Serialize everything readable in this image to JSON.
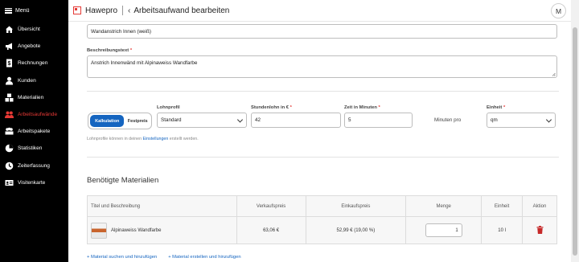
{
  "sidebar": {
    "menu_label": "Menü",
    "items": [
      {
        "label": "Übersicht",
        "icon": "home-icon"
      },
      {
        "label": "Angebote",
        "icon": "megaphone-icon"
      },
      {
        "label": "Rechnungen",
        "icon": "invoice-icon"
      },
      {
        "label": "Kunden",
        "icon": "user-icon"
      },
      {
        "label": "Materialien",
        "icon": "boxes-icon"
      },
      {
        "label": "Arbeitsaufwände",
        "icon": "people-icon",
        "active": true
      },
      {
        "label": "Arbeitspakete",
        "icon": "package-icon"
      },
      {
        "label": "Statistiken",
        "icon": "pie-chart-icon"
      },
      {
        "label": "Zeiterfassung",
        "icon": "clock-icon"
      },
      {
        "label": "Visitenkarte",
        "icon": "id-card-icon"
      }
    ]
  },
  "header": {
    "app_name": "Hawepro",
    "back_symbol": "‹",
    "title": "Arbeitsaufwand bearbeiten",
    "avatar_initial": "M"
  },
  "form": {
    "name_value": "Wandanstrich Innen (weiß)",
    "description_label": "Beschreibungstext",
    "description_value": "Anstrich Innenwänd mit Alpinaweiss Wandfarbe",
    "required_mark": "*",
    "mode_toggle": {
      "active": "Kalkulation",
      "inactive": "Festpreis"
    },
    "lohnprofil_label": "Lohnprofil",
    "lohnprofil_value": "Standard",
    "stundenlohn_label": "Stundenlohn in €",
    "stundenlohn_value": "42",
    "zeit_label": "Zeit in Minuten",
    "zeit_value": "5",
    "minuten_pro": "Minuten pro",
    "einheit_label": "Einheit",
    "einheit_value": "qm",
    "hint_prefix": "Lohnprofile können in deinen ",
    "hint_link": "Einstellungen",
    "hint_suffix": " erstellt werden."
  },
  "materials": {
    "section_title": "Benötigte Materialien",
    "columns": [
      "Titel und Beschreibung",
      "Verkaufspreis",
      "Einkaufspreis",
      "Menge",
      "Einheit",
      "Aktion"
    ],
    "rows": [
      {
        "title": "Alpinaweiss Wandfarbe",
        "verkaufspreis": "63,06 €",
        "einkaufspreis": "52,99 € (19,00 %)",
        "menge": "1",
        "einheit": "10 l",
        "action_icon": "trash-icon"
      }
    ],
    "link_search": "+ Material suchen und hinzufügen",
    "link_create": "+ Material erstellen und hinzufügen"
  },
  "colors": {
    "accent": "#1565c0",
    "active_nav": "#e53935",
    "sidebar_bg": "#000000",
    "delete": "#c62828"
  }
}
